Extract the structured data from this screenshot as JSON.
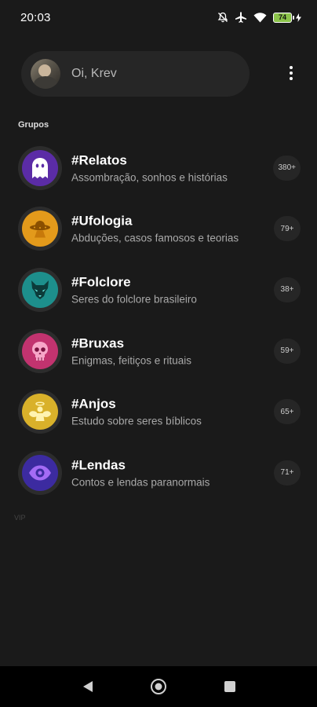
{
  "status_bar": {
    "time": "20:03",
    "battery_level": "74"
  },
  "header": {
    "greeting": "Oi, Krev"
  },
  "section": {
    "title": "Grupos"
  },
  "groups": [
    {
      "name": "#Relatos",
      "description": "Assombração, sonhos e histórias",
      "count": "380+",
      "color": "#5b2ca6",
      "icon": "ghost-icon"
    },
    {
      "name": "#Ufologia",
      "description": "Abduções, casos famosos e teorias",
      "count": "79+",
      "color": "#e39a1b",
      "icon": "ufo-icon"
    },
    {
      "name": "#Folclore",
      "description": "Seres do folclore brasileiro",
      "count": "38+",
      "color": "#1d8f8c",
      "icon": "wolf-icon"
    },
    {
      "name": "#Bruxas",
      "description": "Enigmas, feitiços e rituais",
      "count": "59+",
      "color": "#c2336f",
      "icon": "skull-icon"
    },
    {
      "name": "#Anjos",
      "description": "Estudo sobre seres bíblicos",
      "count": "65+",
      "color": "#d9b12a",
      "icon": "angel-icon"
    },
    {
      "name": "#Lendas",
      "description": "Contos e lendas paranormais",
      "count": "71+",
      "color": "#3c2ba0",
      "icon": "eye-icon"
    }
  ],
  "footer": {
    "faint_text": "VIP"
  }
}
